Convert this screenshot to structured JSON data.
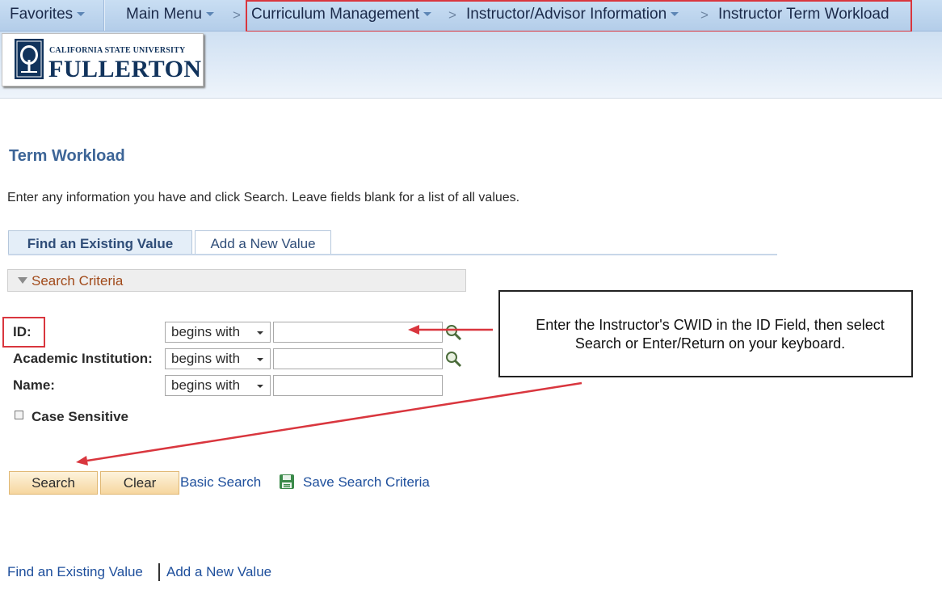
{
  "nav": {
    "favorites": "Favorites",
    "main_menu": "Main Menu",
    "crumbs": [
      "Curriculum Management",
      "Instructor/Advisor Information",
      "Instructor Term Workload"
    ],
    "separator": ">"
  },
  "logo": {
    "line1": "CALIFORNIA STATE UNIVERSITY",
    "line2": "FULLERTON"
  },
  "page": {
    "title": "Term Workload",
    "instructions": "Enter any information you have and click Search. Leave fields blank for a list of all values."
  },
  "tabs": {
    "find": "Find an Existing Value",
    "add": "Add a New Value"
  },
  "criteria": {
    "label": "Search Criteria",
    "fields": [
      {
        "label": "ID:",
        "operator": "begins with",
        "value": ""
      },
      {
        "label": "Academic Institution:",
        "operator": "begins with",
        "value": ""
      },
      {
        "label": "Name:",
        "operator": "begins with",
        "value": ""
      }
    ],
    "case_sensitive": "Case Sensitive"
  },
  "buttons": {
    "search": "Search",
    "clear": "Clear",
    "basic_search": "Basic Search",
    "save_search": "Save Search Criteria"
  },
  "callout": {
    "text": "Enter the Instructor's CWID in the ID Field, then select Search or Enter/Return on your keyboard."
  },
  "footer": {
    "find": "Find an Existing Value",
    "add": "Add a New Value"
  },
  "colors": {
    "highlight": "#d9363e",
    "link": "#1e4f9c",
    "title": "#3d6597"
  }
}
